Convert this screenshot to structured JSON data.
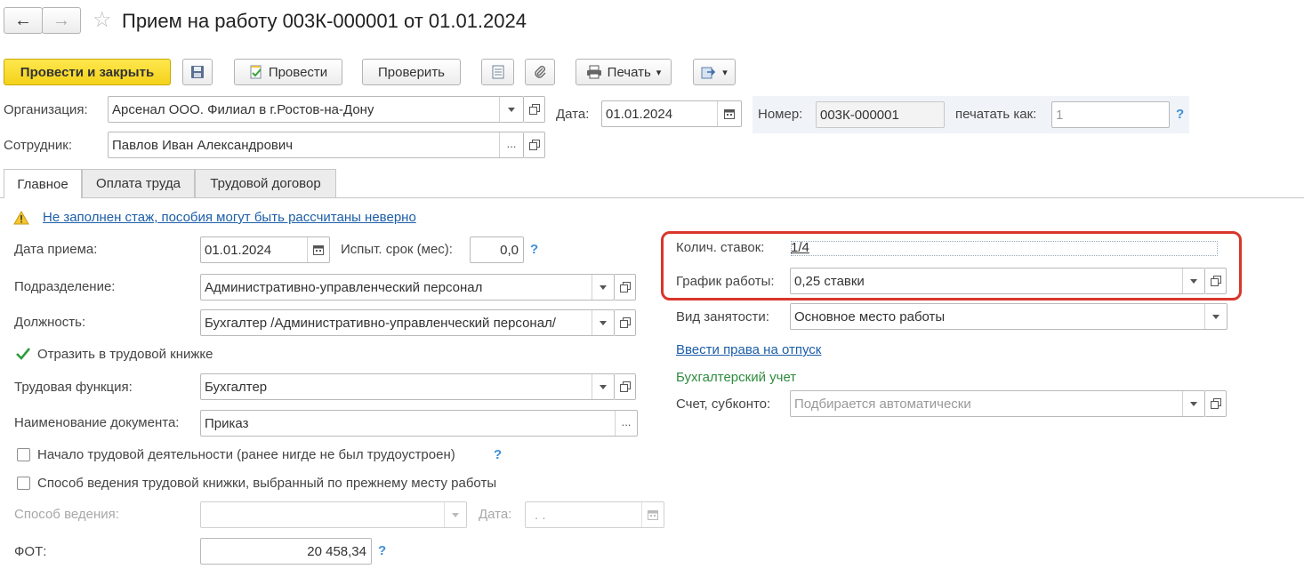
{
  "nav": {
    "back_label": "←",
    "forward_label": "→",
    "star_label": "☆"
  },
  "window": {
    "title": "Прием на работу 003К-000001 от 01.01.2024"
  },
  "toolbar": {
    "post_close": "Провести и закрыть",
    "post": "Провести",
    "check": "Проверить",
    "print": "Печать",
    "more_arrow": "▾"
  },
  "header": {
    "org_label": "Организация:",
    "org_value": "Арсенал ООО. Филиал в г.Ростов-на-Дону",
    "date_label": "Дата:",
    "date_value": "01.01.2024",
    "number_label": "Номер:",
    "number_value": "003К-000001",
    "print_as_label": "печатать как:",
    "print_as_placeholder": "1",
    "employee_label": "Сотрудник:",
    "employee_value": "Павлов Иван Александрович",
    "help": "?"
  },
  "tabs": [
    {
      "label": "Главное"
    },
    {
      "label": "Оплата труда"
    },
    {
      "label": "Трудовой договор"
    }
  ],
  "main": {
    "warning_text": "Не заполнен стаж, пособия могут быть рассчитаны неверно",
    "hire_date_label": "Дата приема:",
    "hire_date_value": "01.01.2024",
    "probation_label": "Испыт. срок (мес):",
    "probation_value": "0,0",
    "department_label": "Подразделение:",
    "department_value": "Административно-управленческий персонал",
    "position_label": "Должность:",
    "position_value": "Бухгалтер /Административно-управленческий персонал/",
    "workbook_label": "Отразить в трудовой книжке",
    "function_label": "Трудовая функция:",
    "function_value": "Бухгалтер",
    "docname_label": "Наименование документа:",
    "docname_value": "Приказ",
    "career_start_label": "Начало трудовой деятельности (ранее нигде не был трудоустроен)",
    "workbook_method_label": "Способ ведения трудовой книжки, выбранный по прежнему месту работы",
    "method_label": "Способ ведения:",
    "method_date_label": "Дата:",
    "method_date_value": " .  .",
    "fot_label": "ФОТ:",
    "fot_value": "20 458,34"
  },
  "right": {
    "rates_label": "Колич. ставок:",
    "rates_value": "1/4",
    "schedule_label": "График работы:",
    "schedule_value": "0,25 ставки",
    "employment_label": "Вид занятости:",
    "employment_value": "Основное место работы",
    "vacation_link": "Ввести права на отпуск",
    "accounting_title": "Бухгалтерский учет",
    "account_label": "Счет, субконто:",
    "account_placeholder": "Подбирается автоматически"
  },
  "colors": {
    "accent": "#f4d21a",
    "highlight": "#d9362b",
    "link": "#1c5ea8",
    "section": "#2e8b3e"
  }
}
